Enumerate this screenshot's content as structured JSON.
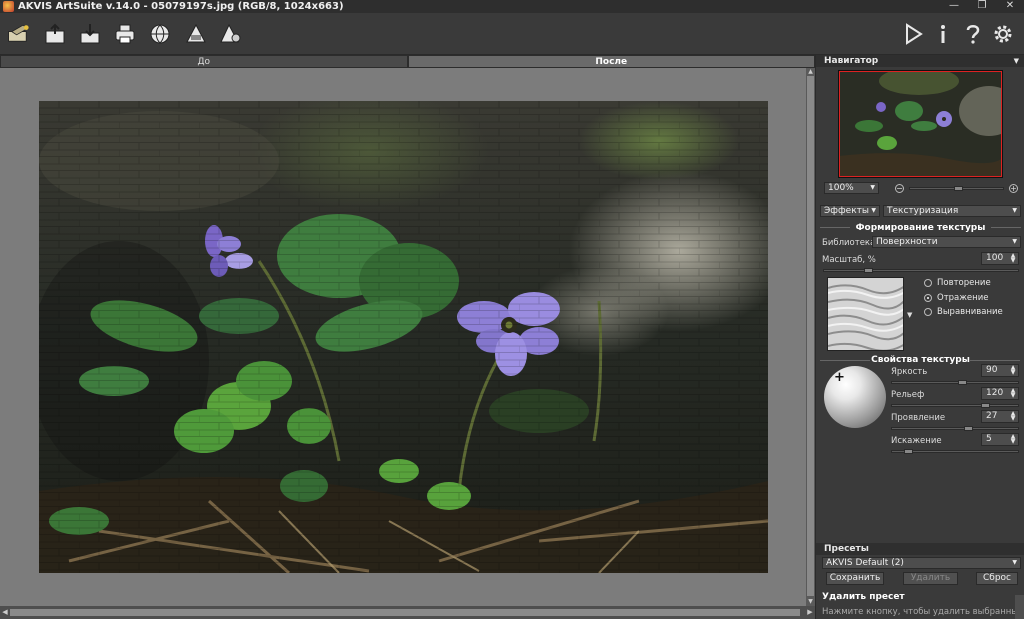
{
  "titlebar": {
    "title": "AKVIS ArtSuite v.14.0 - 05079197s.jpg (RGB/8, 1024x663)",
    "minimize": "—",
    "maximize": "❐",
    "close": "✕"
  },
  "toolbar": {
    "icons": [
      "app-logo-icon",
      "open-image-icon",
      "save-image-icon",
      "print-icon",
      "share-icon",
      "batch-icon",
      "settings-batch-icon",
      "run-icon",
      "info-icon",
      "help-icon",
      "preferences-icon"
    ]
  },
  "tabs": {
    "before": "До",
    "after": "После"
  },
  "navigator": {
    "title": "Навигатор",
    "zoom": "100%",
    "zoom_minus": "−",
    "zoom_plus": "+"
  },
  "effects": {
    "category": "Эффекты",
    "effect": "Текстуризация"
  },
  "texture_formation": {
    "title": "Формирование текстуры",
    "library_label": "Библиотека",
    "library_value": "Поверхности",
    "scale_label": "Масштаб, %",
    "scale_value": "100",
    "modes": [
      {
        "label": "Повторение",
        "selected": false
      },
      {
        "label": "Отражение",
        "selected": true
      },
      {
        "label": "Выравнивание",
        "selected": false
      }
    ]
  },
  "texture_props": {
    "title": "Свойства текстуры",
    "brightness_label": "Яркость",
    "brightness_value": "90",
    "relief_label": "Рельеф",
    "relief_value": "120",
    "emergence_label": "Проявление",
    "emergence_value": "27",
    "distortion_label": "Искажение",
    "distortion_value": "5"
  },
  "presets": {
    "title": "Пресеты",
    "current": "AKVIS Default (2)",
    "save": "Сохранить",
    "delete": "Удалить",
    "reset": "Сброс"
  },
  "hint": {
    "title": "Удалить пресет",
    "text": "Нажмите кнопку, чтобы удалить выбранный"
  },
  "colors": {
    "panel_bg": "#3a3a3a",
    "canvas_bg": "#7c7c7c",
    "flower": "#8d7fd6",
    "leaf": "#4f9a3a"
  }
}
